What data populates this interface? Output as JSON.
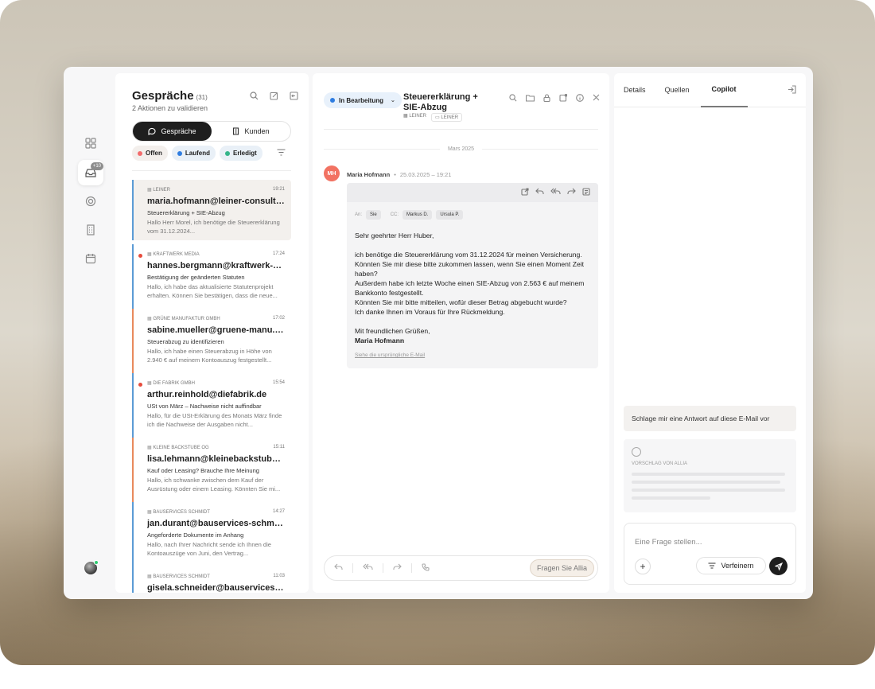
{
  "list": {
    "title": "Gespräche",
    "count": "(31)",
    "subtitle": "2 Aktionen zu validieren",
    "rail_badge": "+10",
    "segments": [
      "Gespräche",
      "Kunden"
    ],
    "filters": [
      {
        "label": "Offen",
        "color": "#f36c6c"
      },
      {
        "label": "Laufend",
        "color": "#2f7de1"
      },
      {
        "label": "Erledigt",
        "color": "#34b58a"
      }
    ],
    "items": [
      {
        "company": "LEINER",
        "time": "19:21",
        "email": "maria.hofmann@leiner-consult.de",
        "subject": "Steuererklärung + SIE-Abzug",
        "preview": "Hallo Herr Morel, ich benötige die Steuererklärung vom 31.12.2024..."
      },
      {
        "company": "KRAFTWERK MEDIA",
        "time": "17:24",
        "email": "hannes.bergmann@kraftwerk-me...",
        "subject": "Bestätigung der geänderten Statuten",
        "preview": "Hallo, ich habe das aktualisierte Statutenprojekt erhalten. Können Sie bestätigen, dass die neue..."
      },
      {
        "company": "GRÜNE MANUFAKTUR GMBH",
        "time": "17:02",
        "email": "sabine.mueller@gruene-manu.de",
        "subject": "Steuerabzug zu identifizieren",
        "preview": "Hallo, ich habe einen Steuerabzug in Höhe von 2.940 € auf meinem Kontoauszug festgestellt..."
      },
      {
        "company": "DIE FABRIK GMBH",
        "time": "15:54",
        "email": "arthur.reinhold@diefabrik.de",
        "subject": "USt von März – Nachweise nicht auffindbar",
        "preview": "Hallo, für die USt-Erklärung des Monats März finde ich die Nachweise der Ausgaben nicht..."
      },
      {
        "company": "KLEINE BACKSTUBE OG",
        "time": "15:11",
        "email": "lisa.lehmann@kleinebackstube.de",
        "subject": "Kauf oder Leasing? Brauche Ihre Meinung",
        "preview": "Hallo, ich schwanke zwischen dem Kauf der Ausrüstung oder einem Leasing. Könnten Sie mi..."
      },
      {
        "company": "BAUSERVICES SCHMIDT",
        "time": "14:27",
        "email": "jan.durant@bauservices-schmidt....",
        "subject": "Angeforderte Dokumente im Anhang",
        "preview": "Hallo, nach Ihrer Nachricht sende ich Ihnen die Kontoauszüge von Juni, den Vertrag..."
      },
      {
        "company": "BAUSERVICES SCHMIDT",
        "time": "11:03",
        "email": "gisela.schneider@bauservices-sch...",
        "subject": "",
        "preview": ""
      }
    ]
  },
  "conversation": {
    "status": "In Bearbeitung",
    "title": "Steuererklärung + SIE-Abzug",
    "tag_company": "LEINER",
    "tag_folder": "LEINER",
    "date_separator": "Mars 2025",
    "sender_initials": "MH",
    "sender_name": "Maria Hofmann",
    "sender_date": "25.03.2025 – 19:21",
    "to_label": "An:",
    "to": "Sie",
    "cc_label": "CC:",
    "cc": [
      "Markus D.",
      "Ursula P."
    ],
    "greeting": "Sehr geehrter Herr Huber,",
    "body": [
      "ich benötige die Steuererklärung vom 31.12.2024 für meinen Versicherung.",
      "Könnten Sie mir diese bitte zukommen lassen, wenn Sie einen Moment Zeit haben?",
      "Außerdem habe ich letzte Woche einen SIE-Abzug von 2.563 € auf meinem Bankkonto festgestellt.",
      "Könnten Sie mir bitte mitteilen, wofür dieser Betrag abgebucht wurde?",
      "Ich danke Ihnen im Voraus für Ihre Rückmeldung."
    ],
    "closing": "Mit freundlichen Grüßen,",
    "signature": "Maria Hofmann",
    "original_link": "Siehe die ursprüngliche E-Mail",
    "ask_button": "Fragen Sie Allia"
  },
  "copilot": {
    "tabs": [
      "Details",
      "Quellen",
      "Copilot"
    ],
    "suggestion": "Schlage mir eine Antwort auf diese E-Mail vor",
    "answer_label": "VORSCHLAG VON ALLIA",
    "input_placeholder": "Eine Frage stellen...",
    "refine_label": "Verfeinern"
  }
}
